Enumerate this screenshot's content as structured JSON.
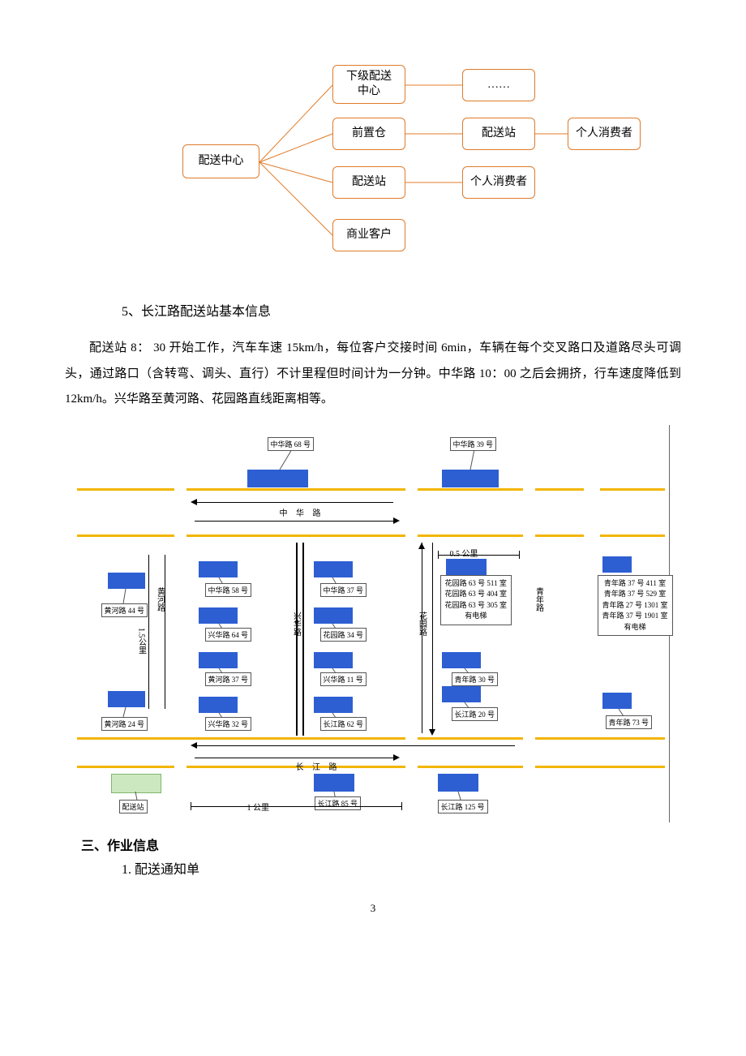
{
  "tree": {
    "root": "配送中心",
    "a1": "下级配送\n中心",
    "a2": "前置仓",
    "a3": "配送站",
    "a4": "商业客户",
    "b1": "……",
    "b2": "配送站",
    "b3": "个人消费者",
    "c1": "个人消费者"
  },
  "heading5": "5、长江路配送站基本信息",
  "paragraph": "配送站 8：  30 开始工作，汽车车速 15km/h，每位客户交接时间 6min，车辆在每个交叉路口及道路尽头可调头，通过路口（含转弯、调头、直行）不计里程但时间计为一分钟。中华路 10：00 之后会拥挤，行车速度降低到 12km/h。兴华路至黄河路、花园路直线距离相等。",
  "map": {
    "road_zhonghua": "中 华 路",
    "road_changjiang": "长 江 路",
    "road_huanghe_v": "黄河路",
    "road_xinghua_v": "兴华路",
    "road_huayuan_v": "花园路",
    "road_qingnian_v": "青年路",
    "dist_05": "0.5 公里",
    "dist_15": "1.5公里",
    "dist_1": "1 公里",
    "peisongzhan": "配送站",
    "zh68": "中华路 68 号",
    "zh39": "中华路 39 号",
    "zh58": "中华路 58 号",
    "zh37": "中华路 37 号",
    "xh64": "兴华路 64 号",
    "hy34": "花园路 34 号",
    "hh37": "黄河路 37 号",
    "xh11": "兴华路 11 号",
    "xh32": "兴华路 32 号",
    "cj62": "长江路 62 号",
    "qn30": "青年路 30 号",
    "cj20": "长江路 20 号",
    "qn73": "青年路 73 号",
    "hh44": "黄河路 44 号",
    "hh24": "黄河路 24 号",
    "cj85": "长江路 85 号",
    "cj125": "长江路 125 号",
    "hy63_block": "花园路 63 号 511 室\n花园路 63 号 404 室\n花园路 63 号 305 室\n有电梯",
    "qn37_block": "青年路 37 号 411 室\n青年路 37 号 529 室\n青年路 27 号 1301 室\n青年路 37 号 1901 室\n有电梯"
  },
  "heading3": "三、作业信息",
  "sub1": "1. 配送通知单",
  "pagenum": "3"
}
